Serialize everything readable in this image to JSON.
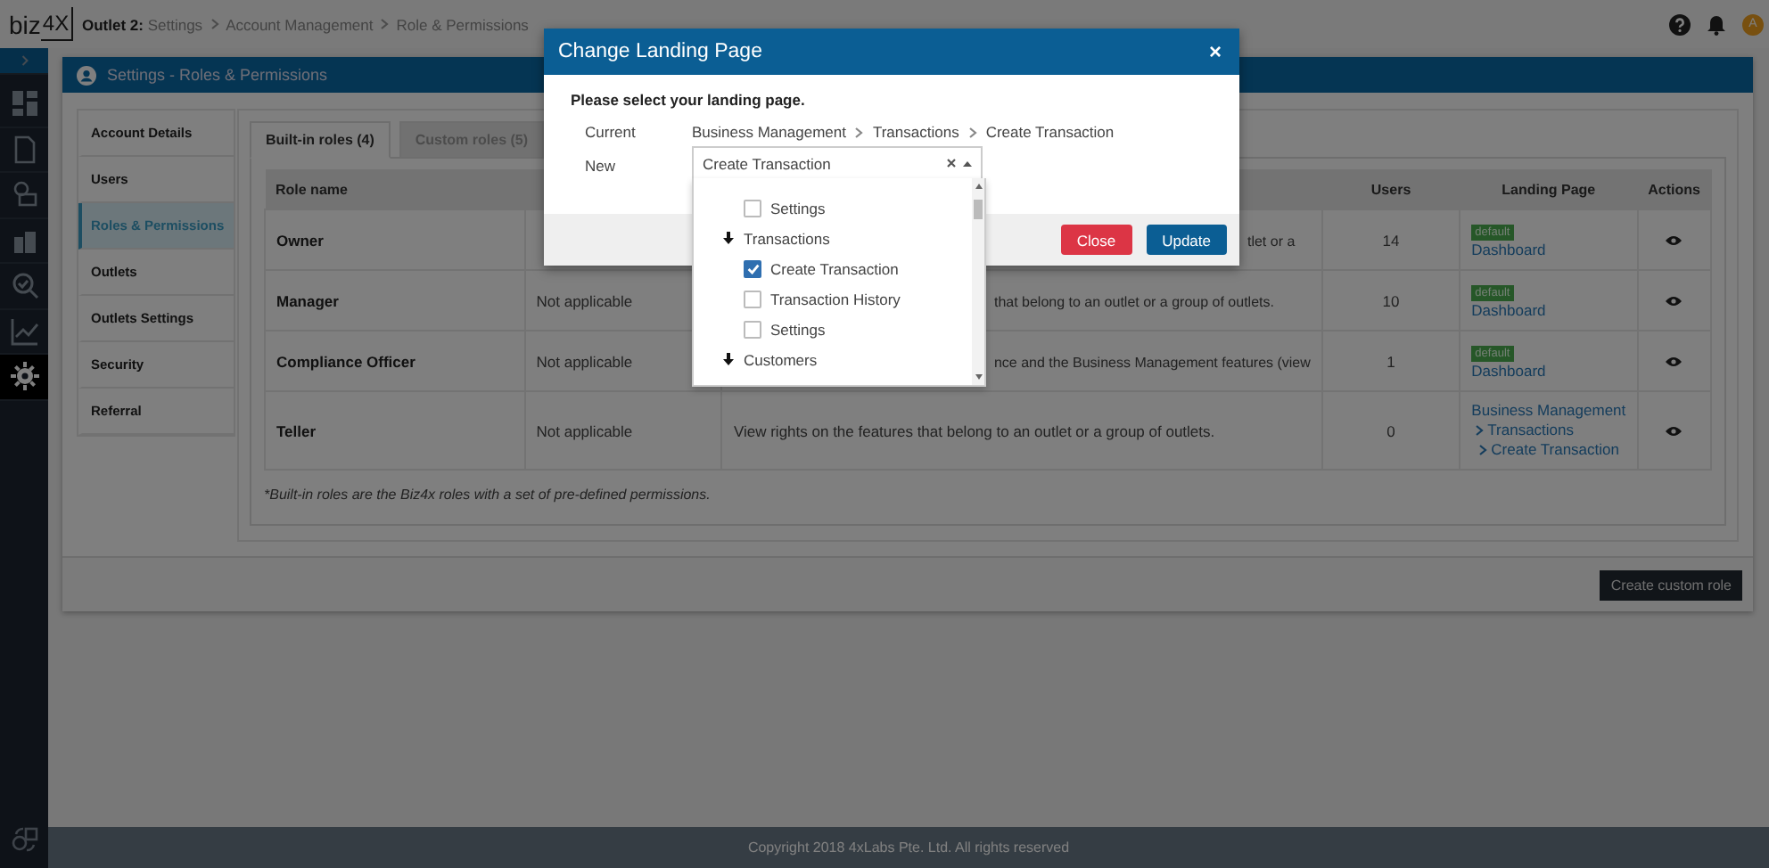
{
  "topbar": {
    "logo": {
      "text": "biz",
      "boxed": "4X"
    },
    "breadcrumb": [
      "**Outlet 2:** Settings",
      "Account Management",
      "Role & Permissions"
    ],
    "avatar": "A"
  },
  "sidebar": {
    "items": [
      {
        "selected": false
      },
      {
        "selected": false
      },
      {
        "selected": false
      },
      {
        "selected": false
      },
      {
        "selected": false
      },
      {
        "selected": false
      },
      {
        "selected": false
      },
      {
        "selected": true
      }
    ]
  },
  "panel": {
    "title": "Settings - Roles & Permissions",
    "nav": [
      {
        "label": "Account Details",
        "selected": false
      },
      {
        "label": "Users",
        "selected": false
      },
      {
        "label": "Roles & Permissions",
        "selected": true
      },
      {
        "label": "Outlets",
        "selected": false
      },
      {
        "label": "Outlets Settings",
        "selected": false
      },
      {
        "label": "Security",
        "selected": false
      },
      {
        "label": "Referral",
        "selected": false
      }
    ],
    "tabs": [
      {
        "label": "Built-in roles (4)",
        "selected": true
      },
      {
        "label": "Custom roles (5)",
        "selected": false
      }
    ],
    "table": {
      "columns": {
        "role": "Role name",
        "users": "Users",
        "landing_page": "Landing Page",
        "actions": "Actions"
      },
      "rows": [
        {
          "role": "Owner",
          "column_3": "tlet or a",
          "users": "14",
          "badge": "default",
          "landing": [
            "Dashboard"
          ]
        },
        {
          "role": "Manager",
          "column_2": "Not applicable",
          "column_3": "that belong to an outlet or a group of outlets.",
          "users": "10",
          "badge": "default",
          "landing": [
            "Dashboard"
          ]
        },
        {
          "role": "Compliance Officer",
          "column_2": "Not applicable",
          "column_3": "nce and the Business Management features (view",
          "users": "1",
          "badge": "default",
          "landing": [
            "Dashboard"
          ]
        },
        {
          "role": "Teller",
          "column_2": "Not applicable",
          "column_3": "View rights on the features that belong to an outlet or a group of outlets.",
          "users": "0",
          "landing": [
            "Business Management",
            "Transactions",
            "Create Transaction"
          ]
        }
      ]
    },
    "footnote": "*Built-in roles are the Biz4x roles with a set of pre-defined permissions.",
    "create_button": "Create custom role"
  },
  "footer": {
    "copyright": "Copyright 2018 4xLabs Pte. Ltd. All rights reserved"
  },
  "modal": {
    "title": "Change Landing Page",
    "close": "×",
    "prompt": "Please select your landing page.",
    "current_label": "Current",
    "current_path": [
      "Business Management",
      "Transactions",
      "Create Transaction"
    ],
    "new_label": "New",
    "select_value": "Create Transaction",
    "options": [
      {
        "kind": "option",
        "label": "Settings",
        "checked": false
      },
      {
        "kind": "group",
        "label": "Transactions",
        "expanded": true,
        "children": [
          {
            "kind": "option",
            "label": "Create Transaction",
            "checked": true
          },
          {
            "kind": "option",
            "label": "Transaction History",
            "checked": false
          },
          {
            "kind": "option",
            "label": "Settings",
            "checked": false
          }
        ]
      },
      {
        "kind": "group",
        "label": "Customers",
        "expanded": true
      }
    ],
    "buttons": [
      {
        "label": "Close",
        "kind": "danger"
      },
      {
        "label": "Update",
        "kind": "primary"
      }
    ]
  }
}
